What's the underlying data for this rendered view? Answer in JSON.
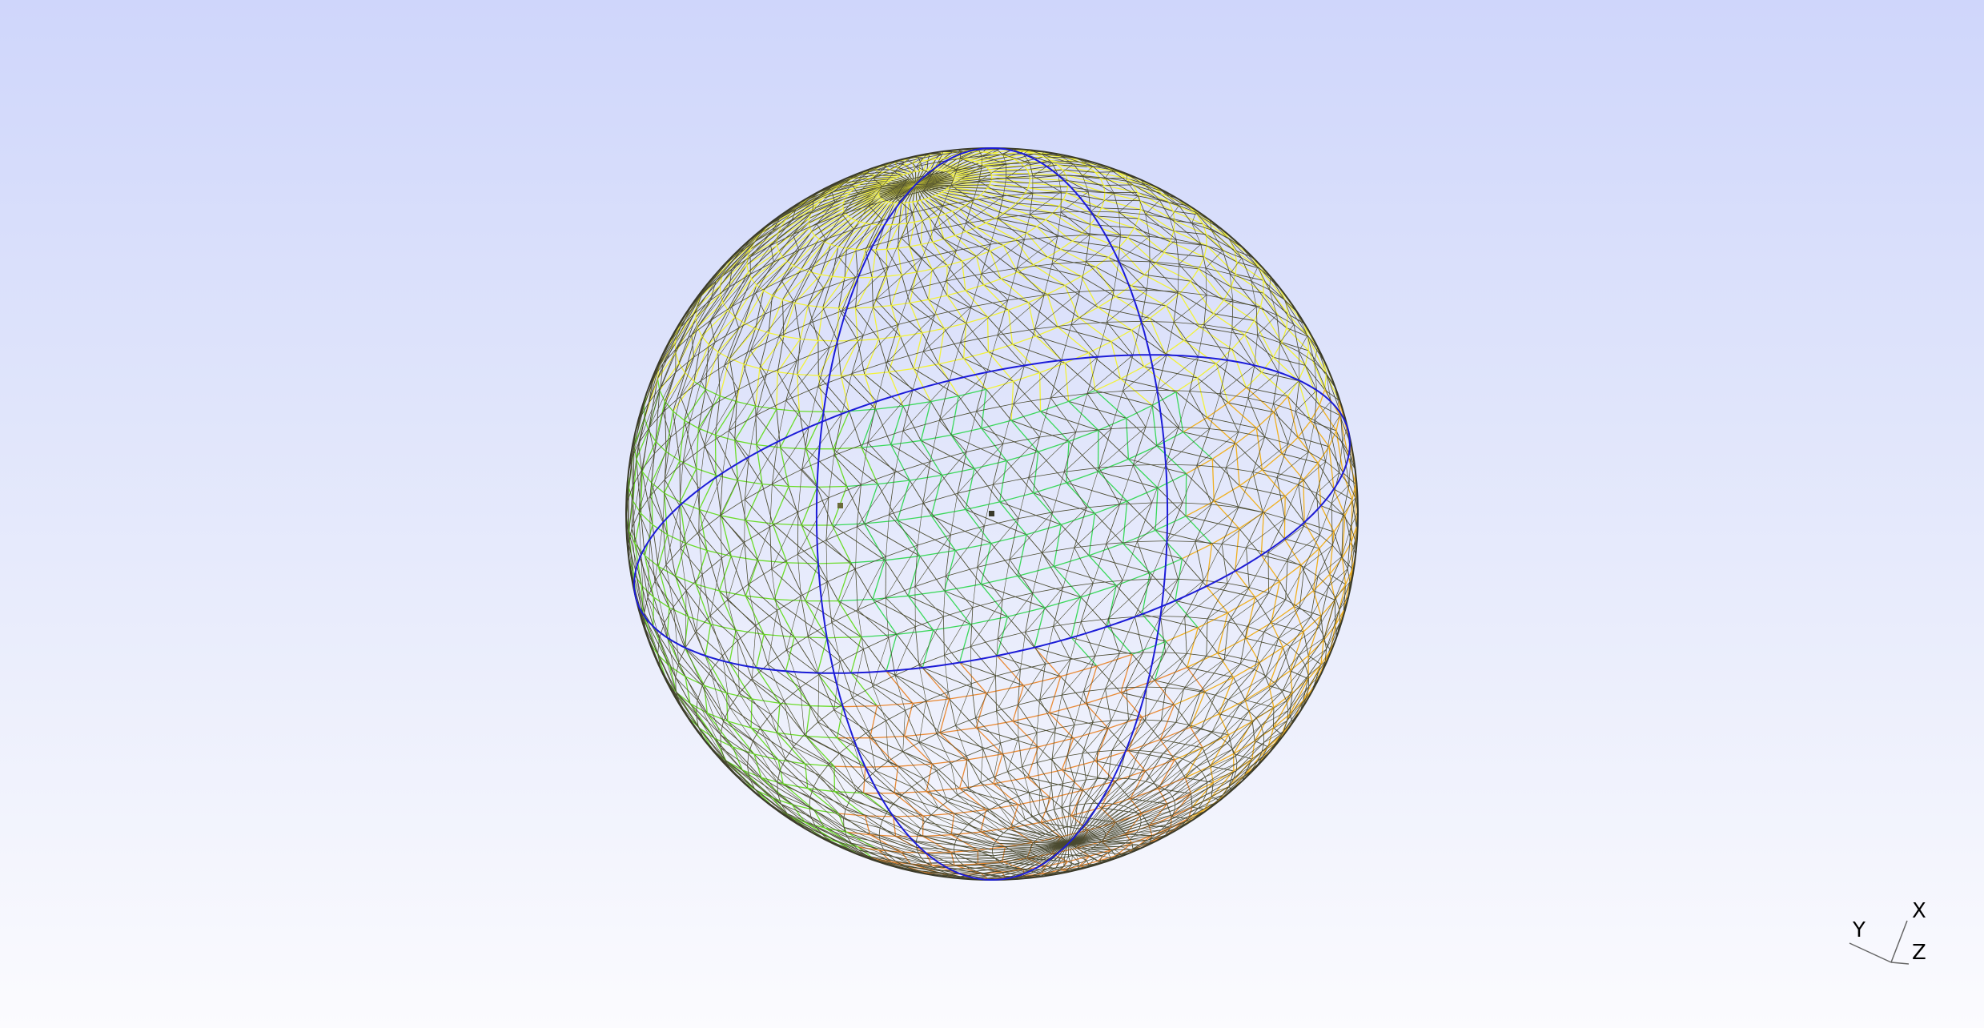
{
  "viewer": {
    "background_top_color": "#cfd6fb",
    "background_bottom_color": "#fbfbfe",
    "mesh_colors": [
      "#f2f23a",
      "#f0b021",
      "#6bdc2a",
      "#3ad85a",
      "#e98a35"
    ],
    "edge_color": "#4a4a30",
    "seam_color": "#1c1cd8"
  },
  "triad": {
    "x_label": "X",
    "y_label": "Y",
    "z_label": "Z"
  }
}
